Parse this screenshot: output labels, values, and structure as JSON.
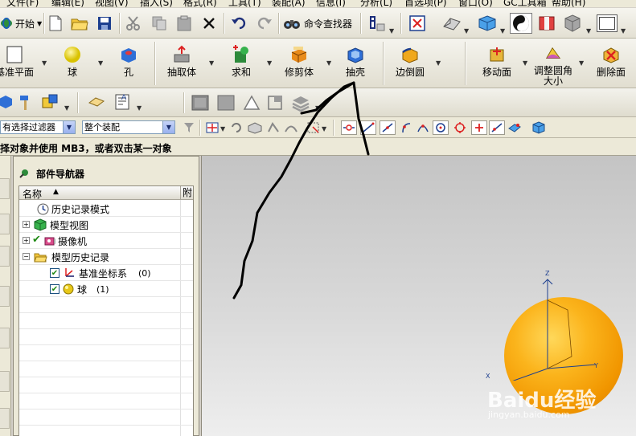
{
  "menubar": {
    "items": [
      "文件(F)",
      "编辑(E)",
      "视图(V)",
      "插入(S)",
      "格式(R)",
      "工具(T)",
      "装配(A)",
      "信息(I)",
      "分析(L)",
      "首选项(P)",
      "窗口(O)",
      "GC工具箱",
      "帮助(H)"
    ]
  },
  "standard_toolbar": {
    "start_label": "开始",
    "command_finder_label": "命令查找器"
  },
  "feature_toolbar": {
    "datum_plane_label": "基准平面",
    "sphere_label": "球",
    "hole_label": "孔",
    "extract_body_label": "抽取体",
    "unite_label": "求和",
    "trim_body_label": "修剪体",
    "shell_label": "抽壳",
    "edge_blend_label": "边倒圆",
    "move_face_label": "移动面",
    "resize_blend_label": "调整圆角大小",
    "delete_face_label": "删除面"
  },
  "selection_bar": {
    "filter_value": "有选择过滤器",
    "scope_value": "整个装配"
  },
  "status": {
    "prompt": "择对象并使用 MB3，或者双击某一对象"
  },
  "navigator": {
    "title": "部件导航器",
    "col_name": "名称",
    "col_extra": "附",
    "items": [
      {
        "label": "历史记录模式"
      },
      {
        "label": "模型视图"
      },
      {
        "label": "摄像机"
      },
      {
        "label": "模型历史记录"
      },
      {
        "label": "基准坐标系",
        "suffix": "(0)"
      },
      {
        "label": "球",
        "suffix": "(1)"
      }
    ]
  },
  "viewport": {
    "axis_z": "Z",
    "axis_x": "X",
    "axis_y": "Y",
    "watermark": "Baidu经验",
    "watermark_url": "jingyan.baidu.com",
    "sphere_color": "#f5a30a"
  }
}
